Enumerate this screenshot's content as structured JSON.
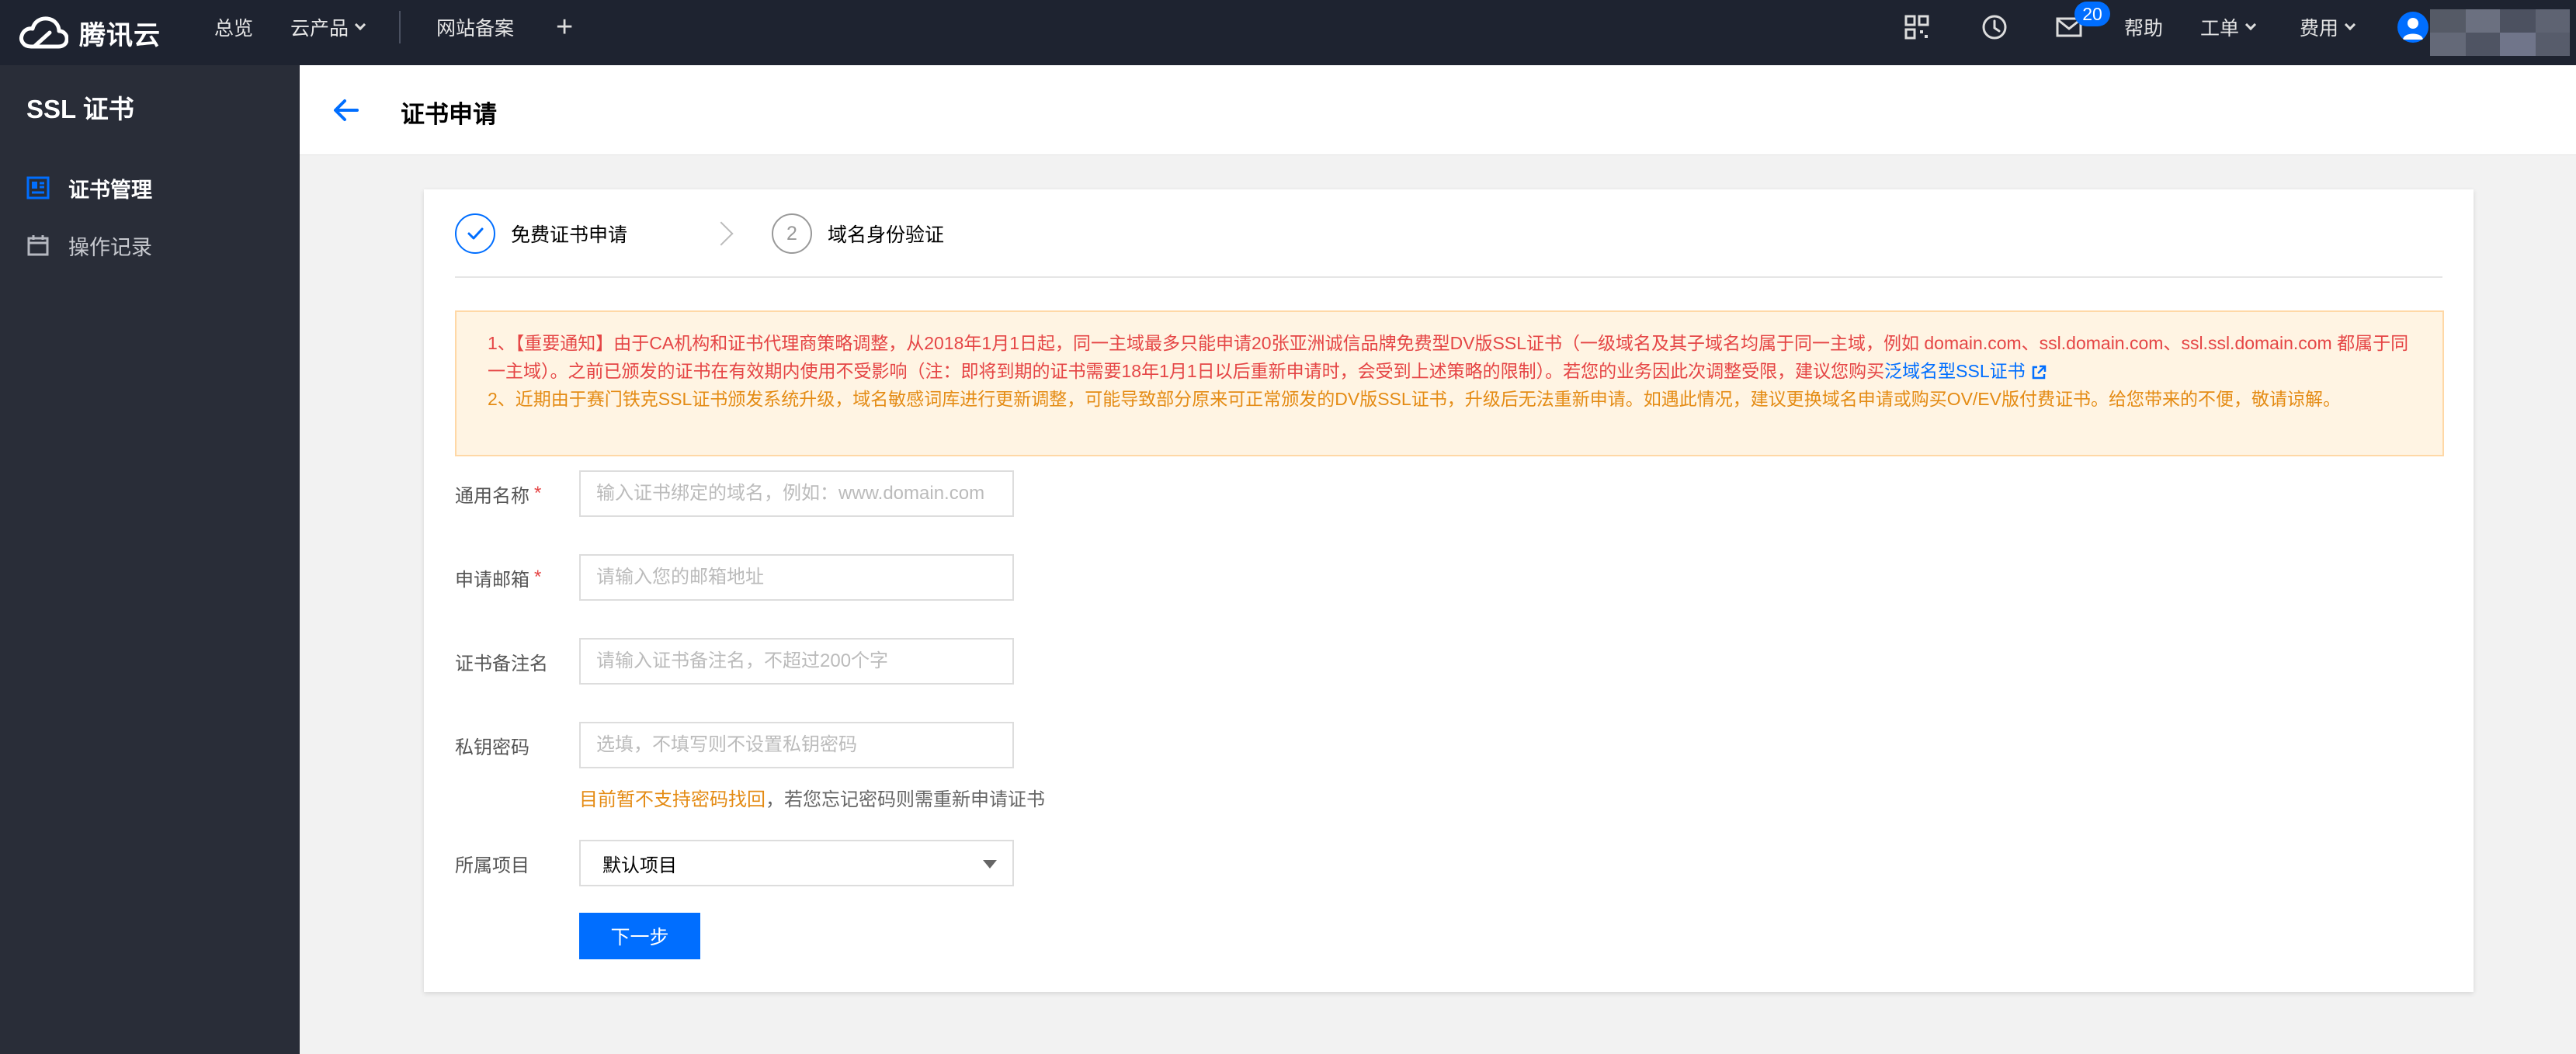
{
  "topbar": {
    "brand": "腾讯云",
    "nav": [
      {
        "label": "总览"
      },
      {
        "label": "云产品"
      },
      {
        "label": "网站备案"
      }
    ],
    "help_label": "帮助",
    "ticket_label": "工单",
    "billing_label": "费用",
    "mail_badge": "20"
  },
  "sidebar": {
    "title": "SSL 证书",
    "items": [
      {
        "label": "证书管理",
        "icon": "certificate-icon",
        "active": true
      },
      {
        "label": "操作记录",
        "icon": "calendar-icon",
        "active": false
      }
    ]
  },
  "header": {
    "title": "证书申请"
  },
  "steps": [
    {
      "label": "免费证书申请",
      "status": "done"
    },
    {
      "label": "域名身份验证",
      "number": "2",
      "status": "todo"
    }
  ],
  "notice": {
    "line1": "1、【重要通知】由于CA机构和证书代理商策略调整，从2018年1月1日起，同一主域最多只能申请20张亚洲诚信品牌免费型DV版SSL证书（一级域名及其子域名均属于同一主域，例如 domain.com、ssl.domain.com、ssl.ssl.domain.com 都属于同一主域）。之前已颁发的证书在有效期内使用不受影响（注：即将到期的证书需要18年1月1日以后重新申请时，会受到上述策略的限制）。若您的业务因此次调整受限，建议您购买",
    "link": "泛域名型SSL证书",
    "line2": "2、近期由于赛门铁克SSL证书颁发系统升级，域名敏感词库进行更新调整，可能导致部分原来可正常颁发的DV版SSL证书，升级后无法重新申请。如遇此情况，建议更换域名申请或购买OV/EV版付费证书。给您带来的不便，敬请谅解。"
  },
  "form": {
    "common_name": {
      "label": "通用名称",
      "required": "*",
      "value": "",
      "placeholder": "输入证书绑定的域名，例如：www.domain.com"
    },
    "email": {
      "label": "申请邮箱",
      "required": "*",
      "value": "",
      "placeholder": "请输入您的邮箱地址"
    },
    "remark": {
      "label": "证书备注名",
      "value": "",
      "placeholder": "请输入证书备注名，不超过200个字"
    },
    "key_password": {
      "label": "私钥密码",
      "value": "",
      "placeholder": "选填，不填写则不设置私钥密码"
    },
    "password_hint_warn": "目前暂不支持密码找回",
    "password_hint_rest": "，若您忘记密码则需重新申请证书",
    "project": {
      "label": "所属项目",
      "selected": "默认项目"
    },
    "next_label": "下一步"
  },
  "colors": {
    "accent": "#006eff",
    "topbar_bg": "#1e2330",
    "sidebar_bg": "#292d38",
    "notice_red": "#e54545",
    "notice_orange": "#e48b14"
  }
}
